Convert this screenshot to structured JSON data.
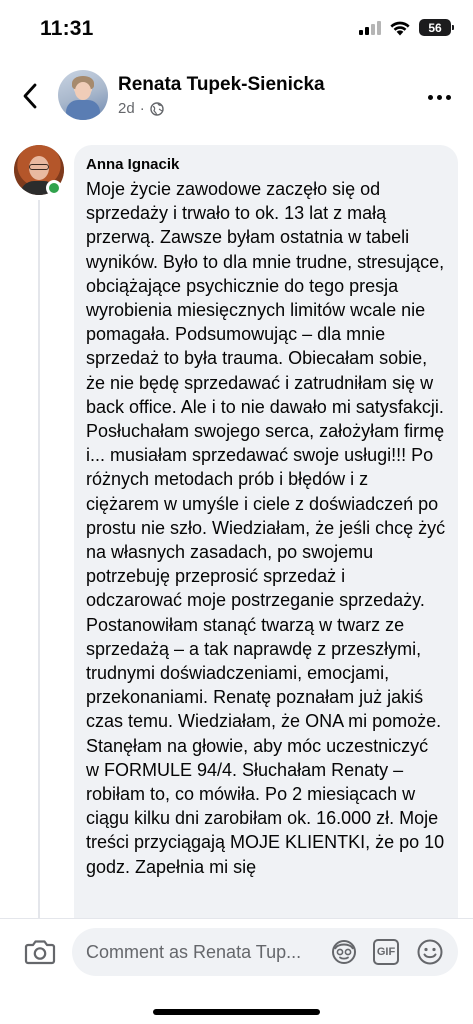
{
  "status_bar": {
    "time": "11:31",
    "battery": "56",
    "icons": [
      "cellular-signal-icon",
      "wifi-icon",
      "battery-icon"
    ]
  },
  "header": {
    "back_icon": "chevron-left-icon",
    "name": "Renata Tupek-Sienicka",
    "time_ago": "2d",
    "separator": "·",
    "privacy_icon": "globe-icon",
    "more_icon": "more-horizontal-icon"
  },
  "comment": {
    "author": "Anna Ignacik",
    "online": true,
    "text": "Moje życie zawodowe zaczęło się od sprzedaży i trwało to ok. 13 lat z małą przerwą. Zawsze byłam ostatnia w tabeli wyników. Było to dla mnie trudne, stresujące, obciążające psychicznie do tego presja wyrobienia miesięcznych limitów wcale nie pomagała. Podsumowując – dla mnie sprzedaż to była trauma. Obiecałam sobie, że nie będę sprzedawać i zatrudniłam się w back office. Ale i to nie dawało mi satysfakcji. Posłuchałam swojego serca, założyłam firmę i... musiałam sprzedawać swoje usługi!!! Po różnych metodach prób i błędów i z ciężarem w umyśle i ciele z doświadczeń po prostu nie szło. Wiedziałam, że jeśli chcę żyć na własnych zasadach, po swojemu potrzebuję przeprosić sprzedaż i odczarować moje postrzeganie sprzedaży. Postanowiłam stanąć twarzą w twarz ze sprzedażą – a tak naprawdę z przeszłymi, trudnymi doświadczeniami, emocjami, przekonaniami. Renatę poznałam już jakiś czas temu. Wiedziałam, że ONA mi pomoże. Stanęłam na głowie, aby móc uczestniczyć w FORMULE 94/4. Słuchałam Renaty – robiłam to, co mówiła. Po 2 miesiącach w ciągu kilku dni zarobiłam ok. 16.000 zł. Moje treści przyciągają MOJE KLIENTKI, że po 10 godz. Zapełnia mi się"
  },
  "composer": {
    "placeholder": "Comment as Renata Tup...",
    "camera_icon": "camera-icon",
    "avatar_sticker_icon": "avatar-sticker-icon",
    "gif_label": "GIF",
    "emoji_icon": "emoji-icon"
  },
  "colors": {
    "text": "#050505",
    "secondary_text": "#65676b",
    "bubble_bg": "#f0f2f5",
    "online": "#31a24c",
    "divider": "#e4e6eb"
  }
}
